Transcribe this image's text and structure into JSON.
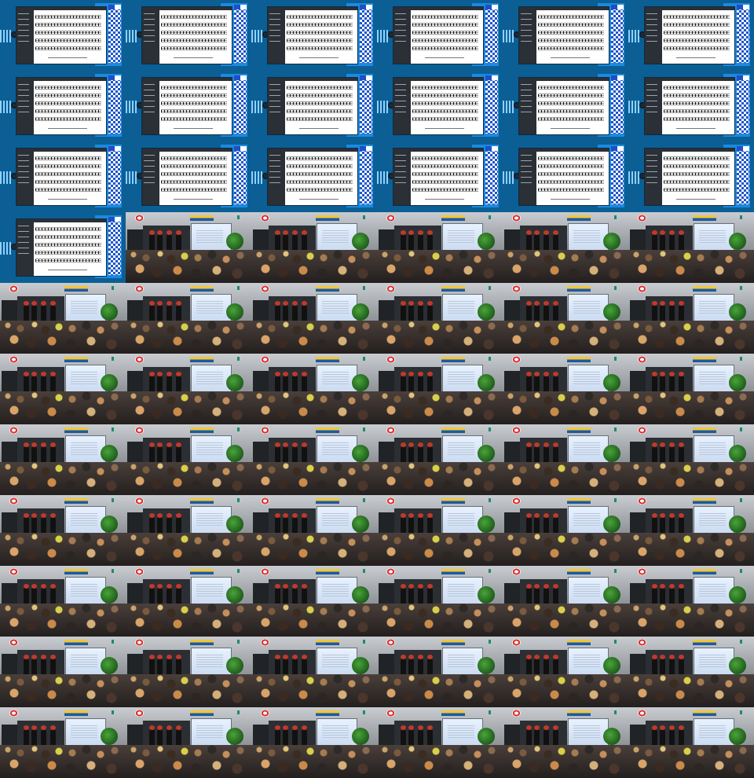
{
  "contact_sheet": {
    "columns": 6,
    "rows": 11,
    "tiles": [
      {
        "scene": "screen-capture"
      },
      {
        "scene": "screen-capture"
      },
      {
        "scene": "screen-capture"
      },
      {
        "scene": "screen-capture"
      },
      {
        "scene": "screen-capture"
      },
      {
        "scene": "screen-capture"
      },
      {
        "scene": "screen-capture"
      },
      {
        "scene": "screen-capture"
      },
      {
        "scene": "screen-capture"
      },
      {
        "scene": "screen-capture"
      },
      {
        "scene": "screen-capture"
      },
      {
        "scene": "screen-capture"
      },
      {
        "scene": "screen-capture"
      },
      {
        "scene": "screen-capture"
      },
      {
        "scene": "screen-capture"
      },
      {
        "scene": "screen-capture"
      },
      {
        "scene": "screen-capture"
      },
      {
        "scene": "screen-capture"
      },
      {
        "scene": "screen-capture"
      },
      {
        "scene": "classroom"
      },
      {
        "scene": "classroom"
      },
      {
        "scene": "classroom"
      },
      {
        "scene": "classroom"
      },
      {
        "scene": "classroom"
      },
      {
        "scene": "classroom"
      },
      {
        "scene": "classroom"
      },
      {
        "scene": "classroom"
      },
      {
        "scene": "classroom"
      },
      {
        "scene": "classroom"
      },
      {
        "scene": "classroom"
      },
      {
        "scene": "classroom"
      },
      {
        "scene": "classroom"
      },
      {
        "scene": "classroom"
      },
      {
        "scene": "classroom"
      },
      {
        "scene": "classroom"
      },
      {
        "scene": "classroom"
      },
      {
        "scene": "classroom"
      },
      {
        "scene": "classroom"
      },
      {
        "scene": "classroom"
      },
      {
        "scene": "classroom"
      },
      {
        "scene": "classroom"
      },
      {
        "scene": "classroom"
      },
      {
        "scene": "classroom"
      },
      {
        "scene": "classroom"
      },
      {
        "scene": "classroom"
      },
      {
        "scene": "classroom"
      },
      {
        "scene": "classroom"
      },
      {
        "scene": "classroom"
      },
      {
        "scene": "classroom"
      },
      {
        "scene": "classroom"
      },
      {
        "scene": "classroom"
      },
      {
        "scene": "classroom"
      },
      {
        "scene": "classroom"
      },
      {
        "scene": "classroom"
      },
      {
        "scene": "classroom"
      },
      {
        "scene": "classroom"
      },
      {
        "scene": "classroom"
      },
      {
        "scene": "classroom"
      },
      {
        "scene": "classroom"
      },
      {
        "scene": "classroom"
      },
      {
        "scene": "classroom"
      },
      {
        "scene": "classroom"
      },
      {
        "scene": "classroom"
      },
      {
        "scene": "classroom"
      },
      {
        "scene": "classroom"
      },
      {
        "scene": "classroom"
      }
    ]
  },
  "colors": {
    "screen_background": "#0b5f95",
    "screen_accent": "#1a8ae0",
    "qr_blue": "#1f55c9",
    "classroom_wall": "#c9ccd0",
    "projector_screen": "#e8f2ff",
    "plant_green": "#4aa33a"
  }
}
